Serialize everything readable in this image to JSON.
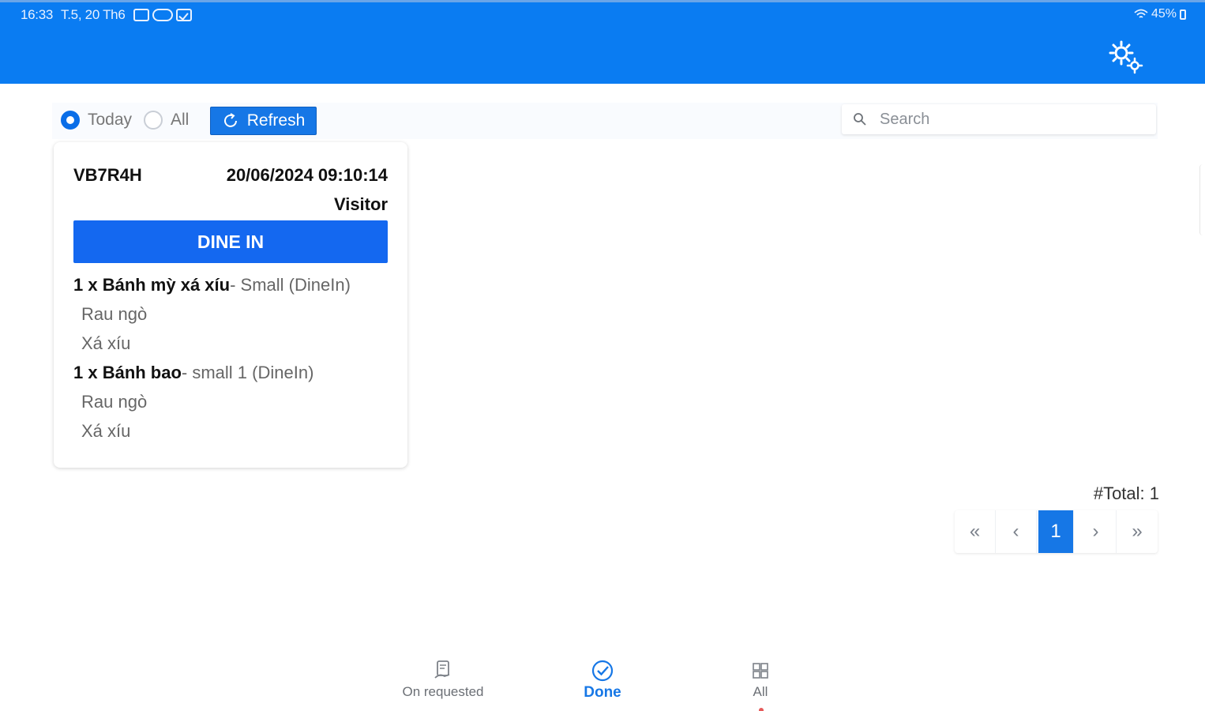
{
  "status_bar": {
    "time": "16:33",
    "date": "T.5, 20 Th6",
    "battery": "45%"
  },
  "toolbar": {
    "filter_today": "Today",
    "filter_all": "All",
    "selected_filter": "Today",
    "refresh_label": "Refresh",
    "search_placeholder": "Search",
    "search_value": ""
  },
  "order": {
    "code": "VB7R4H",
    "datetime": "20/06/2024 09:10:14",
    "customer": "Visitor",
    "type": "DINE IN",
    "type_color": "#1468f0",
    "items": [
      {
        "main": "1 x Bánh mỳ xá xíu",
        "sub": " - Small (DineIn)",
        "options": [
          "Rau ngò",
          "Xá xíu"
        ]
      },
      {
        "main": "1 x Bánh bao",
        "sub": " - small 1 (DineIn)",
        "options": [
          "Rau ngò",
          "Xá xíu"
        ]
      }
    ]
  },
  "pagination": {
    "total_label": "#Total: 1",
    "first": "«",
    "prev": "‹",
    "current_page": "1",
    "next": "›",
    "last": "»"
  },
  "bottom_nav": {
    "items": [
      {
        "label": "On requested",
        "icon": "requested-icon",
        "active": false
      },
      {
        "label": "Done",
        "icon": "check-circle-icon",
        "active": true
      },
      {
        "label": "All",
        "icon": "grid-icon",
        "active": false
      }
    ]
  },
  "colors": {
    "header": "#0a7cf2",
    "accent": "#1677e6",
    "dine_in": "#1468f0"
  }
}
